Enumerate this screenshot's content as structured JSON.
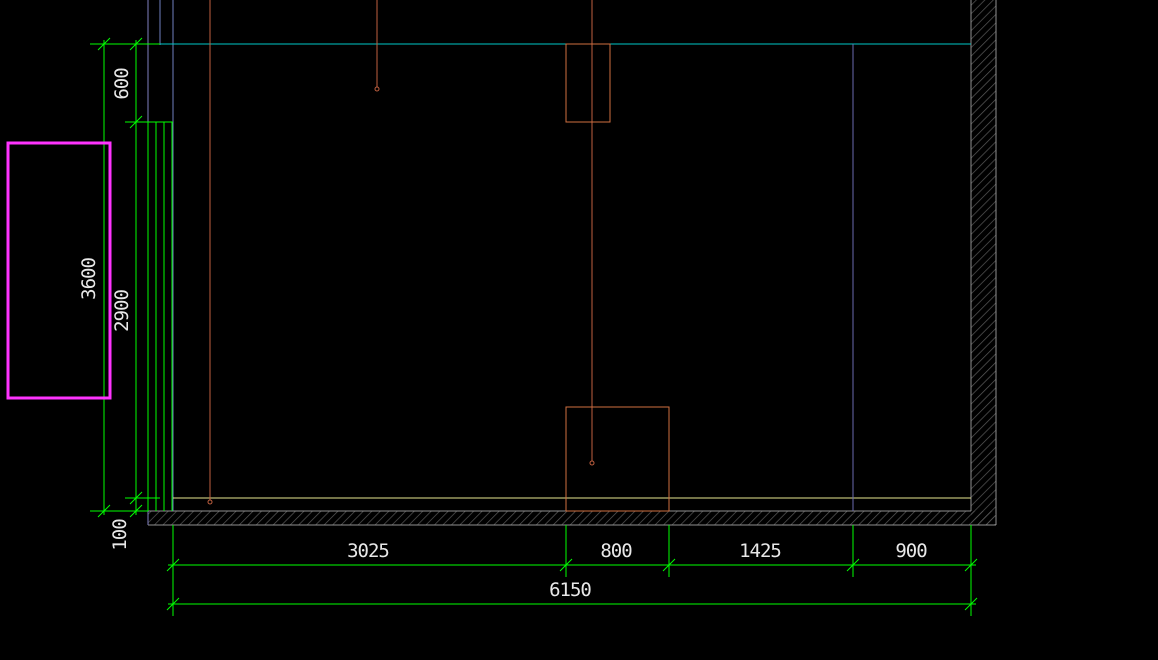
{
  "drawing": {
    "colors": {
      "background": "#000000",
      "dimension": "#00ff00",
      "wall": "#808080",
      "wall_hatch": "#5a5a5a",
      "ceiling_line": "#00c8c8",
      "floor_line": "#e8e890",
      "pipe": "#c06040",
      "outlet_box": "#d07040",
      "guide_line": "#6a6ab0",
      "highlight": "#ff33ff",
      "text": "#e8e8e8"
    },
    "dimensions": {
      "vertical": {
        "top_segment": "600",
        "middle_segment": "2900",
        "bottom_segment": "100",
        "overall": "3600"
      },
      "horizontal": {
        "segments": [
          "3025",
          "800",
          "1425",
          "900"
        ],
        "overall": "6150"
      }
    }
  }
}
